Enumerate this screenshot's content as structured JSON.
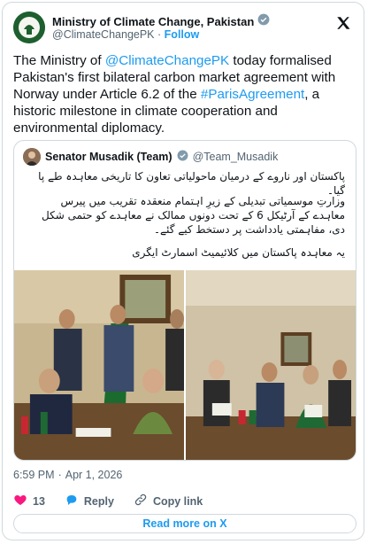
{
  "author": {
    "name": "Ministry of Climate Change, Pakistan",
    "handle": "@ClimateChangePK",
    "separator": "·",
    "follow_label": "Follow"
  },
  "tweet": {
    "text_1": "The Ministry of ",
    "mention": "@ClimateChangePK",
    "text_2": " today formalised Pakistan's first bilateral carbon market agreement with Norway under Article 6.2 of the ",
    "hashtag": "#ParisAgreement",
    "text_3": ", a historic milestone in climate cooperation and environmental diplomacy."
  },
  "quote": {
    "name": "Senator Musadik (Team)",
    "handle": "@Team_Musadik",
    "para_1": "پاکستان اور ناروے کے درمیان ماحولیاتی تعاون کا تاریخی معاہدہ طے پا گیا۔",
    "para_2": "وزارتِ موسمیاتی تبدیلی کے زیرِ اہتمام منعقدہ تقریب میں پیرس معاہدے کے آرٹیکل 6 کے تحت دونوں ممالک نے معاہدے کو حتمی شکل دی، مفاہمتی یادداشت پر دستخط کیے گئے۔",
    "para_3": "یہ معاہدہ پاکستان میں کلائیمیٹ اسمارٹ ایگری"
  },
  "meta": {
    "time": "6:59 PM",
    "separator": "·",
    "date": "Apr 1, 2026"
  },
  "actions": {
    "likes": "13",
    "reply_label": "Reply",
    "copy_link_label": "Copy link"
  },
  "read_more_label": "Read more on X",
  "colors": {
    "accent": "#1d9bf0",
    "like": "#f91880",
    "text": "#0f1419",
    "muted": "#536471",
    "border": "#cfd9de"
  }
}
